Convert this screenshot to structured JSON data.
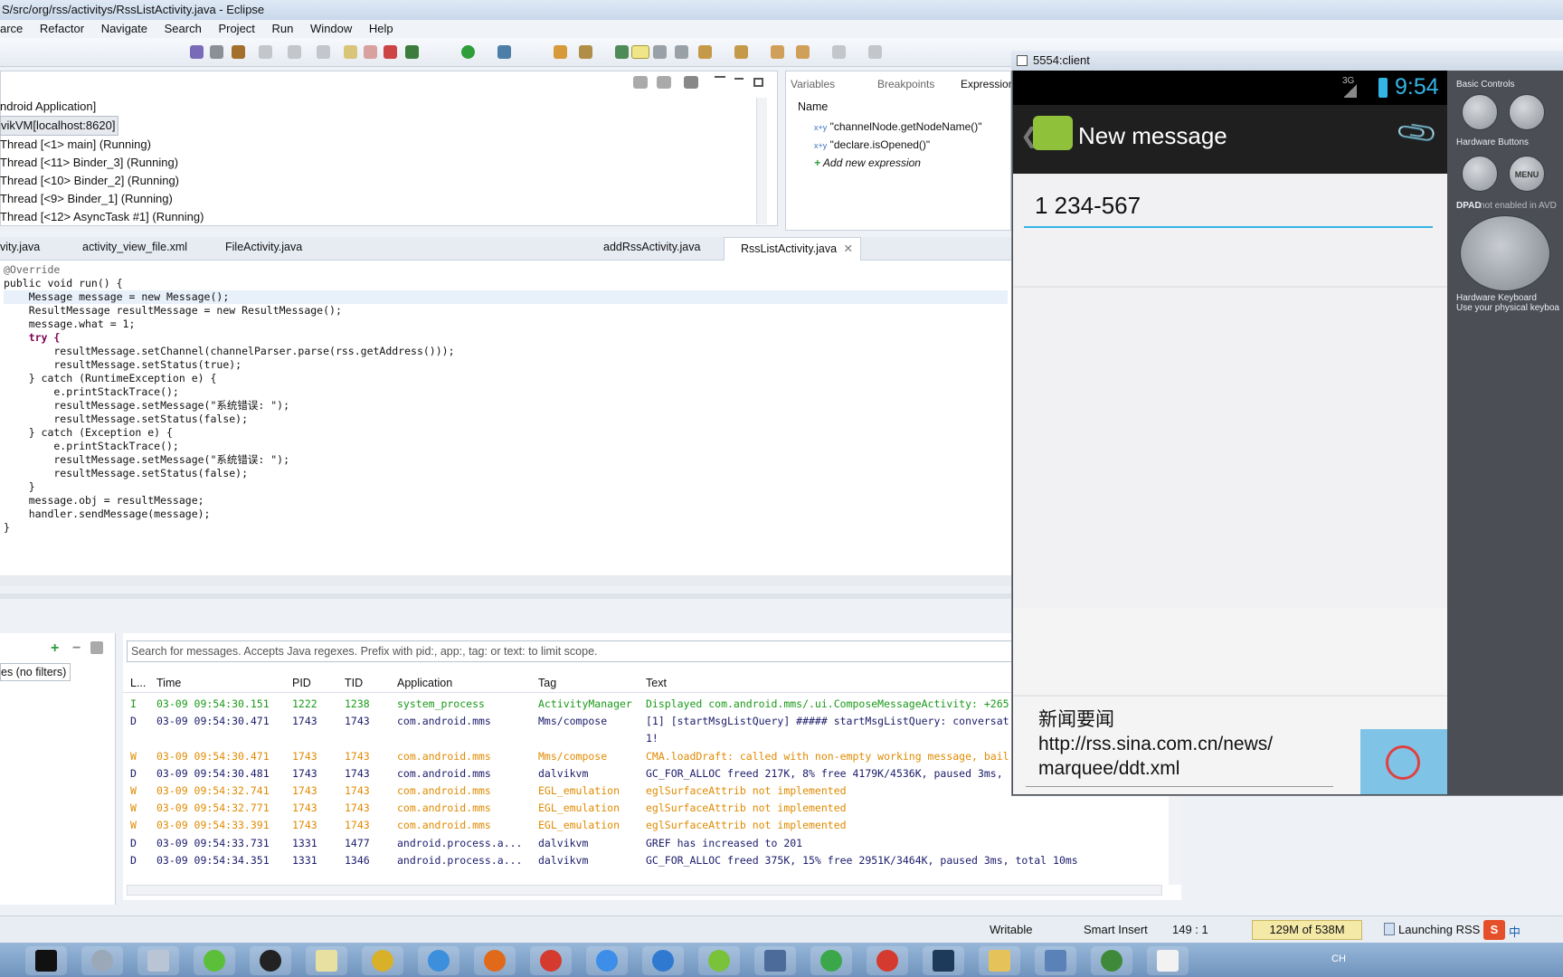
{
  "window": {
    "title": "S/src/org/rss/activitys/RssListActivity.java - Eclipse"
  },
  "menu": [
    "arce",
    "Refactor",
    "Navigate",
    "Search",
    "Project",
    "Run",
    "Window",
    "Help"
  ],
  "debug": {
    "tree": [
      "ndroid Application]",
      "vikVM[localhost:8620]",
      "Thread [<1> main] (Running)",
      "Thread [<11> Binder_3] (Running)",
      "Thread [<10> Binder_2] (Running)",
      "Thread [<9> Binder_1] (Running)",
      "Thread [<12> AsyncTask #1] (Running)"
    ]
  },
  "vars": {
    "tabs": [
      "Variables",
      "Breakpoints",
      "Expression"
    ],
    "column": "Name",
    "rows": [
      "\"channelNode.getNodeName()\"",
      "\"declare.isOpened()\"",
      "Add new expression"
    ]
  },
  "editor": {
    "tabs": [
      "vity.java",
      "activity_view_file.xml",
      "FileActivity.java",
      "addRssActivity.java",
      "RssListActivity.java"
    ],
    "lines": [
      "@Override",
      "public void run() {",
      "    Message message = new Message();",
      "    ResultMessage resultMessage = new ResultMessage();",
      "    message.what = 1;",
      "    try {",
      "        resultMessage.setChannel(channelParser.parse(rss.getAddress()));",
      "        resultMessage.setStatus(true);",
      "    } catch (RuntimeException e) {",
      "        e.printStackTrace();",
      "        resultMessage.setMessage(\"系统错误: \");",
      "        resultMessage.setStatus(false);",
      "    } catch (Exception e) {",
      "        e.printStackTrace();",
      "        resultMessage.setMessage(\"系统错误: \");",
      "        resultMessage.setStatus(false);",
      "    }",
      "    message.obj = resultMessage;",
      "    handler.sendMessage(message);",
      "}"
    ]
  },
  "logcat": {
    "filter_label": "es (no filters)",
    "search_placeholder": "Search for messages. Accepts Java regexes. Prefix with pid:, app:, tag: or text: to limit scope.",
    "headers": [
      "L...",
      "Time",
      "PID",
      "TID",
      "Application",
      "Tag",
      "Text"
    ],
    "rows": [
      {
        "level": "I",
        "time": "03-09 09:54:30.151",
        "pid": "1222",
        "tid": "1238",
        "app": "system_process",
        "tag": "ActivityManager",
        "text": "Displayed com.android.mms/.ui.ComposeMessageActivity: +265",
        "color": "#1a9a1a"
      },
      {
        "level": "D",
        "time": "03-09 09:54:30.471",
        "pid": "1743",
        "tid": "1743",
        "app": "com.android.mms",
        "tag": "Mms/compose",
        "text": "[1] [startMsgListQuery] ##### startMsgListQuery: conversat",
        "color": "#1b1b6b"
      },
      {
        "level": "",
        "time": "",
        "pid": "",
        "tid": "",
        "app": "",
        "tag": "",
        "text": "1!",
        "color": "#1b1b6b"
      },
      {
        "level": "W",
        "time": "03-09 09:54:30.471",
        "pid": "1743",
        "tid": "1743",
        "app": "com.android.mms",
        "tag": "Mms/compose",
        "text": "CMA.loadDraft: called with non-empty working message, bail",
        "color": "#e08a00"
      },
      {
        "level": "D",
        "time": "03-09 09:54:30.481",
        "pid": "1743",
        "tid": "1743",
        "app": "com.android.mms",
        "tag": "dalvikvm",
        "text": "GC_FOR_ALLOC freed 217K, 8% free 4179K/4536K, paused 3ms,",
        "color": "#1b1b6b"
      },
      {
        "level": "W",
        "time": "03-09 09:54:32.741",
        "pid": "1743",
        "tid": "1743",
        "app": "com.android.mms",
        "tag": "EGL_emulation",
        "text": "eglSurfaceAttrib not implemented",
        "color": "#e08a00"
      },
      {
        "level": "W",
        "time": "03-09 09:54:32.771",
        "pid": "1743",
        "tid": "1743",
        "app": "com.android.mms",
        "tag": "EGL_emulation",
        "text": "eglSurfaceAttrib not implemented",
        "color": "#e08a00"
      },
      {
        "level": "W",
        "time": "03-09 09:54:33.391",
        "pid": "1743",
        "tid": "1743",
        "app": "com.android.mms",
        "tag": "EGL_emulation",
        "text": "eglSurfaceAttrib not implemented",
        "color": "#e08a00"
      },
      {
        "level": "D",
        "time": "03-09 09:54:33.731",
        "pid": "1331",
        "tid": "1477",
        "app": "android.process.a...",
        "tag": "dalvikvm",
        "text": "GREF has increased to 201",
        "color": "#1b1b6b"
      },
      {
        "level": "D",
        "time": "03-09 09:54:34.351",
        "pid": "1331",
        "tid": "1346",
        "app": "android.process.a...",
        "tag": "dalvikvm",
        "text": "GC_FOR_ALLOC freed 375K, 15% free 2951K/3464K, paused 3ms, total 10ms",
        "color": "#1b1b6b"
      }
    ]
  },
  "status": {
    "mode": "Writable",
    "insert": "Smart Insert",
    "position": "149 : 1",
    "memory": "129M of 538M",
    "job": "Launching RSS"
  },
  "emulator": {
    "title": "5554:client",
    "clock": "9:54",
    "network": "3G",
    "screen_title": "New message",
    "recipient": "1 234-567",
    "message_line1": "新闻要闻",
    "message_line2": "http://rss.sina.com.cn/news/",
    "message_line3": "marquee/ddt.xml",
    "hw": {
      "basic_controls": "Basic Controls",
      "hardware_buttons": "Hardware Buttons",
      "dpad_label": "DPAD",
      "dpad_note": "not enabled in AVD",
      "keyboard": "Hardware Keyboard",
      "keyboard_note": "Use your physical keyboa",
      "menu_label": "MENU"
    }
  },
  "tray": {
    "lang": "CH",
    "ime": "中"
  },
  "colors": {
    "accent": "#33b5e5",
    "emu_bg": "#4b4f55",
    "warn": "#e08a00",
    "info": "#1a9a1a"
  }
}
